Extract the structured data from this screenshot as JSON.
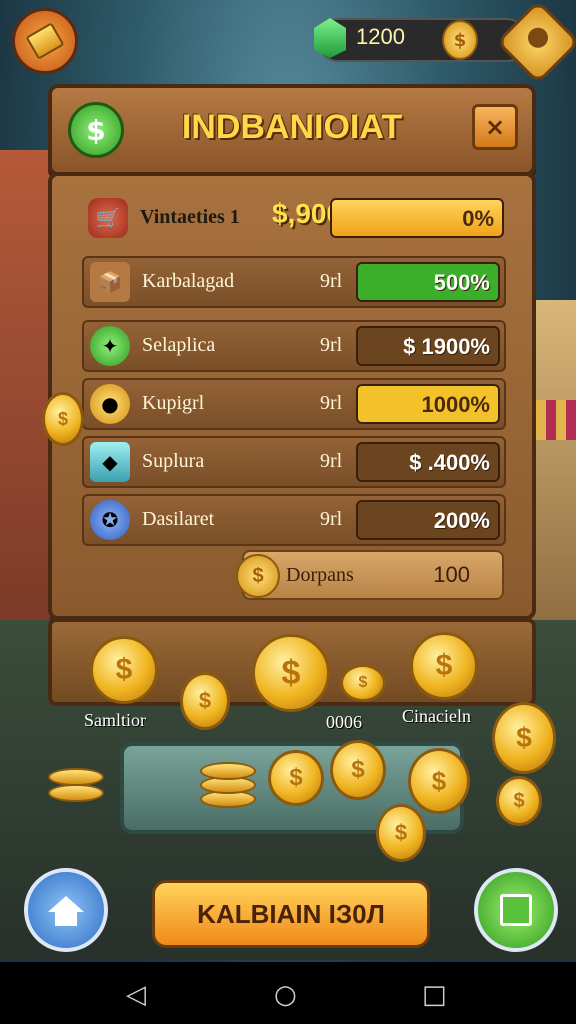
{
  "resources": {
    "gems": "1200",
    "coin_symbol": "$"
  },
  "header": {
    "title": "INDBANIOIAT",
    "close": "×",
    "coin_symbol": "$"
  },
  "rows": [
    {
      "name": "Vintaeties 1",
      "cash": "$,900",
      "unit": "",
      "pct": "0%",
      "fill": 0.0,
      "bar_color": "#f3b12a",
      "icon": "cart-icon"
    },
    {
      "name": "Karbalagad",
      "unit": "9rl",
      "pct": "500%",
      "fill": 1.0,
      "bar_color": "#3caf2a",
      "icon": "crate-icon"
    },
    {
      "name": "Selaplica",
      "unit": "9rl",
      "pct": "$ 1900%",
      "fill": 0.0,
      "bar_color": "#6b4520",
      "icon": "leaf-icon"
    },
    {
      "name": "Kupigrl",
      "unit": "9rl",
      "pct": "1000%",
      "fill": 1.0,
      "bar_color": "#f3c12a",
      "icon": "coin-stack-icon"
    },
    {
      "name": "Suplura",
      "unit": "9rl",
      "pct": "$ .400%",
      "fill": 0.0,
      "bar_color": "#6b4520",
      "icon": "box-icon"
    },
    {
      "name": "Dasilaret",
      "unit": "9rl",
      "pct": "200%",
      "fill": 0.0,
      "bar_color": "#6b4520",
      "icon": "badge-icon"
    }
  ],
  "total": {
    "label": "Dorpans",
    "value": "100",
    "coin": "$"
  },
  "board": {
    "left_label": "Samltior",
    "mid_label": "0006",
    "right_label": "Cinacieln",
    "coin": "$"
  },
  "action": {
    "label": "KALBIAIN ІЗ0Л"
  },
  "nav": {
    "back": "◁",
    "home": "○",
    "recents": "□"
  }
}
